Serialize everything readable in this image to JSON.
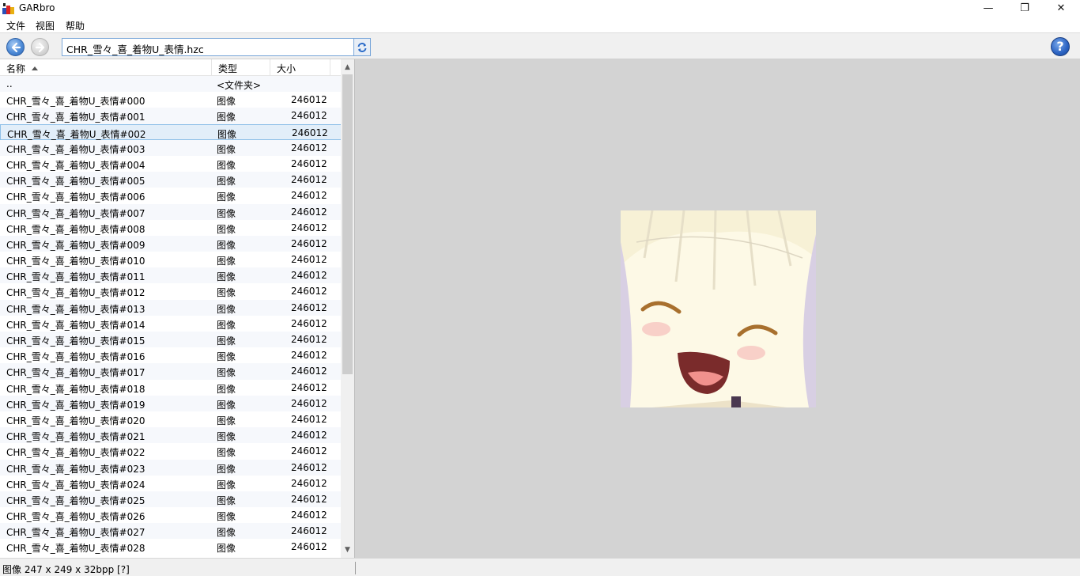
{
  "window": {
    "title": "GARbro",
    "minimize_glyph": "—",
    "maximize_glyph": "❐",
    "close_glyph": "✕"
  },
  "menu": {
    "items": [
      "文件",
      "视图",
      "帮助"
    ]
  },
  "toolbar": {
    "path": "CHR_雪々_喜_着物U_表情.hzc",
    "help_label": "?"
  },
  "list": {
    "headers": {
      "name": "名称",
      "type": "类型",
      "size": "大小"
    },
    "sort": {
      "column": "name",
      "direction": "ascending"
    },
    "parent_row": {
      "name": "..",
      "type": "<文件夹>",
      "size": ""
    },
    "selected_index": 2,
    "rows": [
      {
        "name": "CHR_雪々_喜_着物U_表情#000",
        "type": "图像",
        "size": "246012"
      },
      {
        "name": "CHR_雪々_喜_着物U_表情#001",
        "type": "图像",
        "size": "246012"
      },
      {
        "name": "CHR_雪々_喜_着物U_表情#002",
        "type": "图像",
        "size": "246012"
      },
      {
        "name": "CHR_雪々_喜_着物U_表情#003",
        "type": "图像",
        "size": "246012"
      },
      {
        "name": "CHR_雪々_喜_着物U_表情#004",
        "type": "图像",
        "size": "246012"
      },
      {
        "name": "CHR_雪々_喜_着物U_表情#005",
        "type": "图像",
        "size": "246012"
      },
      {
        "name": "CHR_雪々_喜_着物U_表情#006",
        "type": "图像",
        "size": "246012"
      },
      {
        "name": "CHR_雪々_喜_着物U_表情#007",
        "type": "图像",
        "size": "246012"
      },
      {
        "name": "CHR_雪々_喜_着物U_表情#008",
        "type": "图像",
        "size": "246012"
      },
      {
        "name": "CHR_雪々_喜_着物U_表情#009",
        "type": "图像",
        "size": "246012"
      },
      {
        "name": "CHR_雪々_喜_着物U_表情#010",
        "type": "图像",
        "size": "246012"
      },
      {
        "name": "CHR_雪々_喜_着物U_表情#011",
        "type": "图像",
        "size": "246012"
      },
      {
        "name": "CHR_雪々_喜_着物U_表情#012",
        "type": "图像",
        "size": "246012"
      },
      {
        "name": "CHR_雪々_喜_着物U_表情#013",
        "type": "图像",
        "size": "246012"
      },
      {
        "name": "CHR_雪々_喜_着物U_表情#014",
        "type": "图像",
        "size": "246012"
      },
      {
        "name": "CHR_雪々_喜_着物U_表情#015",
        "type": "图像",
        "size": "246012"
      },
      {
        "name": "CHR_雪々_喜_着物U_表情#016",
        "type": "图像",
        "size": "246012"
      },
      {
        "name": "CHR_雪々_喜_着物U_表情#017",
        "type": "图像",
        "size": "246012"
      },
      {
        "name": "CHR_雪々_喜_着物U_表情#018",
        "type": "图像",
        "size": "246012"
      },
      {
        "name": "CHR_雪々_喜_着物U_表情#019",
        "type": "图像",
        "size": "246012"
      },
      {
        "name": "CHR_雪々_喜_着物U_表情#020",
        "type": "图像",
        "size": "246012"
      },
      {
        "name": "CHR_雪々_喜_着物U_表情#021",
        "type": "图像",
        "size": "246012"
      },
      {
        "name": "CHR_雪々_喜_着物U_表情#022",
        "type": "图像",
        "size": "246012"
      },
      {
        "name": "CHR_雪々_喜_着物U_表情#023",
        "type": "图像",
        "size": "246012"
      },
      {
        "name": "CHR_雪々_喜_着物U_表情#024",
        "type": "图像",
        "size": "246012"
      },
      {
        "name": "CHR_雪々_喜_着物U_表情#025",
        "type": "图像",
        "size": "246012"
      },
      {
        "name": "CHR_雪々_喜_着物U_表情#026",
        "type": "图像",
        "size": "246012"
      },
      {
        "name": "CHR_雪々_喜_着物U_表情#027",
        "type": "图像",
        "size": "246012"
      },
      {
        "name": "CHR_雪々_喜_着物U_表情#028",
        "type": "图像",
        "size": "246012"
      }
    ]
  },
  "status": {
    "text": "图像 247 x 249 x 32bpp [?]"
  },
  "colors": {
    "preview_background": "#d3d3d3",
    "selected_row": "#e2eef9",
    "accent_blue": "#2a62c2"
  },
  "icons": {
    "back": "arrow-left-icon",
    "forward": "arrow-right-icon",
    "refresh": "refresh-icon",
    "help": "help-icon",
    "app": "garbro-app-icon"
  }
}
